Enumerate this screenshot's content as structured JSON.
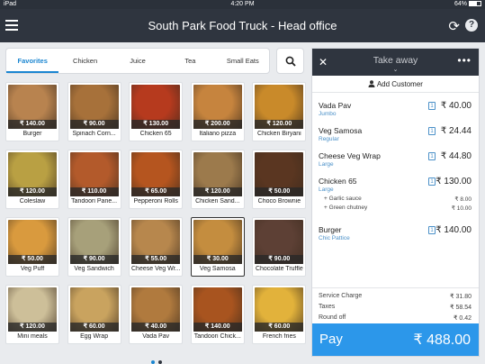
{
  "status_bar": {
    "device": "iPad",
    "time": "4:20 PM",
    "battery": "64%"
  },
  "header": {
    "title": "South Park Food Truck - Head office",
    "menu_icon": "hamburger-icon",
    "sync_icon": "sync-icon",
    "help_icon": "help-icon",
    "help_glyph": "?"
  },
  "categories": [
    {
      "label": "Favorites",
      "active": true
    },
    {
      "label": "Chicken",
      "active": false
    },
    {
      "label": "Juice",
      "active": false
    },
    {
      "label": "Tea",
      "active": false
    },
    {
      "label": "Small Eats",
      "active": false
    }
  ],
  "products": [
    {
      "name": "Burger",
      "price": "₹ 140.00",
      "color": "#b8834f"
    },
    {
      "name": "Spinach Corn...",
      "price": "₹ 90.00",
      "color": "#a7713a"
    },
    {
      "name": "Chicken 65",
      "price": "₹ 130.00",
      "color": "#b63a1e"
    },
    {
      "name": "Italiano pizza",
      "price": "₹ 200.00",
      "color": "#c6843e"
    },
    {
      "name": "Chicken Biryani",
      "price": "₹ 120.00",
      "color": "#c98a2a"
    },
    {
      "name": "Coleslaw",
      "price": "₹ 120.00",
      "color": "#b9a043"
    },
    {
      "name": "Tandoori Pane...",
      "price": "₹ 110.00",
      "color": "#b35a2b"
    },
    {
      "name": "Pepperoni Rolls",
      "price": "₹ 65.00",
      "color": "#b5551f"
    },
    {
      "name": "Chicken Sand...",
      "price": "₹ 120.00",
      "color": "#9c7a4c"
    },
    {
      "name": "Choco Brownie",
      "price": "₹ 50.00",
      "color": "#5a3621"
    },
    {
      "name": "Veg Puff",
      "price": "₹ 50.00",
      "color": "#d99a3e"
    },
    {
      "name": "Veg Sandwich",
      "price": "₹ 90.00",
      "color": "#a7a07a"
    },
    {
      "name": "Cheese Veg Wr...",
      "price": "₹ 55.00",
      "color": "#b7874d"
    },
    {
      "name": "Veg Samosa",
      "price": "₹ 30.00",
      "color": "#c48d3f",
      "selected": true
    },
    {
      "name": "Chocolate Truffle",
      "price": "₹ 90.00",
      "color": "#5d4035"
    },
    {
      "name": "Mini meals",
      "price": "₹ 120.00",
      "color": "#cdbf99"
    },
    {
      "name": "Egg Wrap",
      "price": "₹ 60.00",
      "color": "#c9a35f"
    },
    {
      "name": "Vada Pav",
      "price": "₹ 40.00",
      "color": "#b07a3e"
    },
    {
      "name": "Tandoori Chick...",
      "price": "₹ 140.00",
      "color": "#a8541f"
    },
    {
      "name": "French fries",
      "price": "₹ 60.00",
      "color": "#e2b23b"
    }
  ],
  "pager": {
    "pages": 2,
    "current": 1
  },
  "cart": {
    "mode": "Take away",
    "add_customer": "Add Customer",
    "items": [
      {
        "name": "Vada Pav",
        "sub": "Jumbo",
        "qty": "1",
        "amount": "₹ 40.00",
        "mods": []
      },
      {
        "name": "Veg Samosa",
        "sub": "Regular",
        "qty": "1",
        "amount": "₹ 24.44",
        "mods": []
      },
      {
        "name": "Cheese Veg Wrap",
        "sub": "Large",
        "qty": "1",
        "amount": "₹ 44.80",
        "mods": []
      },
      {
        "name": "Chicken 65",
        "sub": "Large",
        "qty": "1",
        "amount": "₹ 130.00",
        "mods": [
          {
            "name": "+ Garlic sauce",
            "price": "₹ 8.00"
          },
          {
            "name": "+ Green chutney",
            "price": "₹ 10.00"
          }
        ]
      },
      {
        "name": "Burger",
        "sub": "Chic Pattice",
        "qty": "1",
        "amount": "₹ 140.00",
        "mods": []
      }
    ],
    "summary": [
      {
        "label": "Service Charge",
        "value": "₹ 31.80"
      },
      {
        "label": "Taxes",
        "value": "₹ 58.54"
      },
      {
        "label": "Round off",
        "value": "₹ 0.42"
      }
    ],
    "pay_label": "Pay",
    "total": "₹ 488.00"
  },
  "colors": {
    "accent": "#1b86d1",
    "pay": "#2c97ea",
    "header": "#2f353f"
  }
}
